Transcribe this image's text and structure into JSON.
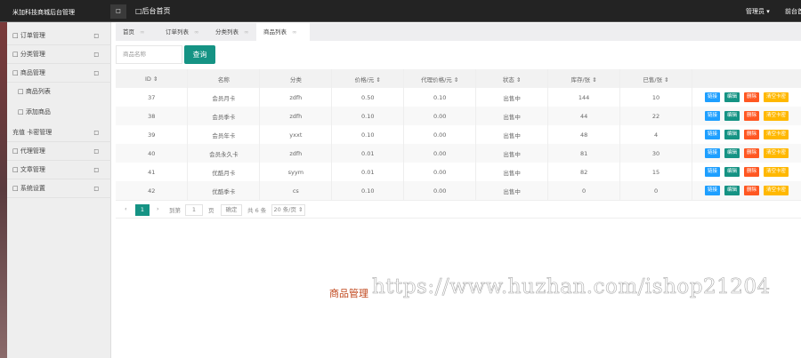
{
  "header": {
    "logo": "米加科技商城后台管理",
    "menu_icon": "□",
    "home": "□后台首页",
    "admin": "管理员 ▾",
    "front": "前台首页"
  },
  "sidebar": {
    "items": [
      {
        "label": "□ 订单管理",
        "arrow": "□"
      },
      {
        "label": "□ 分类管理",
        "arrow": "□"
      },
      {
        "label": "□ 商品管理",
        "arrow": "□"
      },
      {
        "label": "□ 商品列表",
        "arrow": ""
      },
      {
        "label": "□ 添加商品",
        "arrow": ""
      },
      {
        "label": "充值 卡密管理",
        "arrow": "□"
      },
      {
        "label": "□ 代理管理",
        "arrow": "□"
      },
      {
        "label": "□ 文章管理",
        "arrow": "□"
      },
      {
        "label": "□ 系统设置",
        "arrow": "□"
      }
    ]
  },
  "tabs": [
    {
      "label": "首页",
      "close": "∞"
    },
    {
      "label": "订单列表",
      "close": "∞"
    },
    {
      "label": "分类列表",
      "close": "∞"
    },
    {
      "label": "商品列表",
      "close": "∞"
    }
  ],
  "search": {
    "placeholder": "商品名称",
    "button": "查询"
  },
  "table": {
    "headers": [
      "ID ⇕",
      "名称",
      "分类",
      "价格/元 ⇕",
      "代理价格/元 ⇕",
      "状态 ⇕",
      "库存/张 ⇕",
      "已售/张 ⇕",
      ""
    ],
    "rows": [
      [
        "37",
        "会员月卡",
        "zdfh",
        "0.50",
        "0.10",
        "出售中",
        "144",
        "10"
      ],
      [
        "38",
        "会员季卡",
        "zdfh",
        "0.10",
        "0.00",
        "出售中",
        "44",
        "22"
      ],
      [
        "39",
        "会员年卡",
        "yxxt",
        "0.10",
        "0.00",
        "出售中",
        "48",
        "4"
      ],
      [
        "40",
        "会员永久卡",
        "zdfh",
        "0.01",
        "0.00",
        "出售中",
        "81",
        "30"
      ],
      [
        "41",
        "优酷月卡",
        "syym",
        "0.01",
        "0.00",
        "出售中",
        "82",
        "15"
      ],
      [
        "42",
        "优酷季卡",
        "cs",
        "0.10",
        "0.00",
        "出售中",
        "0",
        "0"
      ]
    ],
    "actions": [
      "链接",
      "编辑",
      "删除",
      "清空卡密"
    ]
  },
  "action_colors": [
    "#1e9fff",
    "#159384",
    "#ff5722",
    "#ffb800"
  ],
  "pager": {
    "prev": "‹",
    "current": "1",
    "next": "›",
    "goto": "到第",
    "page_value": "1",
    "page_unit": "页",
    "confirm": "确定",
    "total": "共 6 条",
    "per_page": "20 条/页 ⇕"
  },
  "watermark": {
    "label": "商品管理",
    "url": "https://www.huzhan.com/ishop21204"
  }
}
